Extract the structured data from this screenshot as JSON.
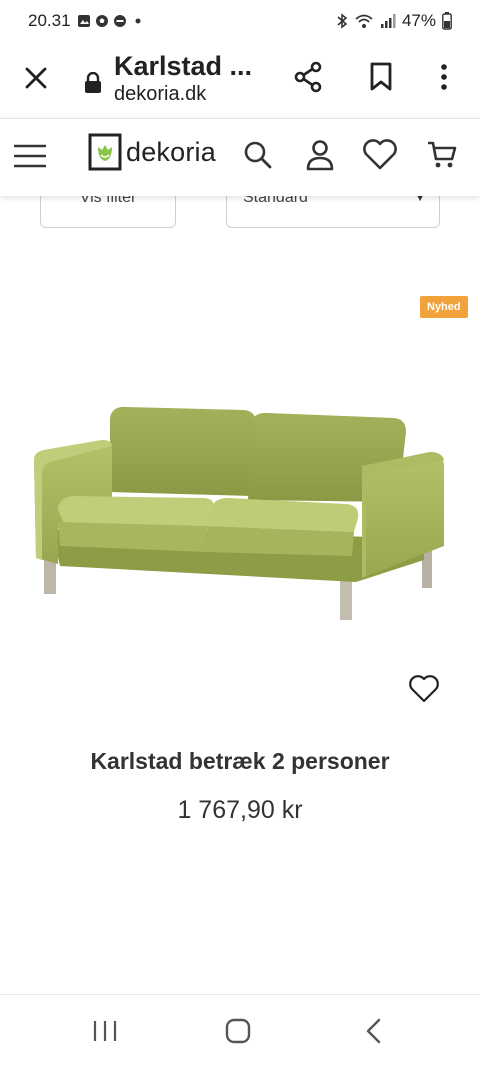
{
  "status_bar": {
    "time": "20.31",
    "battery": "47%",
    "notification_icons": [
      "gallery-icon",
      "football-icon",
      "app-badge-icon",
      "dot-icon"
    ],
    "system_icons": [
      "bluetooth-icon",
      "wifi-icon",
      "signal-icon",
      "battery-icon"
    ]
  },
  "browser": {
    "title": "Karlstad ...",
    "domain": "dekoria.dk",
    "actions": [
      "close-icon",
      "share-icon",
      "bookmark-icon",
      "more-icon"
    ]
  },
  "site_header": {
    "brand": "dekoria",
    "accent_color": "#8bc34a",
    "actions": [
      "search-icon",
      "user-icon",
      "heart-icon",
      "cart-icon"
    ]
  },
  "filters": {
    "filter_label": "Vis filter",
    "sort_value": "Standard"
  },
  "product": {
    "badge": "Nyhed",
    "badge_color": "#f2a23a",
    "name": "Karlstad betræk 2 personer",
    "price": "1 767,90 kr"
  },
  "nav_bar": {
    "buttons": [
      "recent-apps-icon",
      "home-icon",
      "back-icon"
    ]
  }
}
